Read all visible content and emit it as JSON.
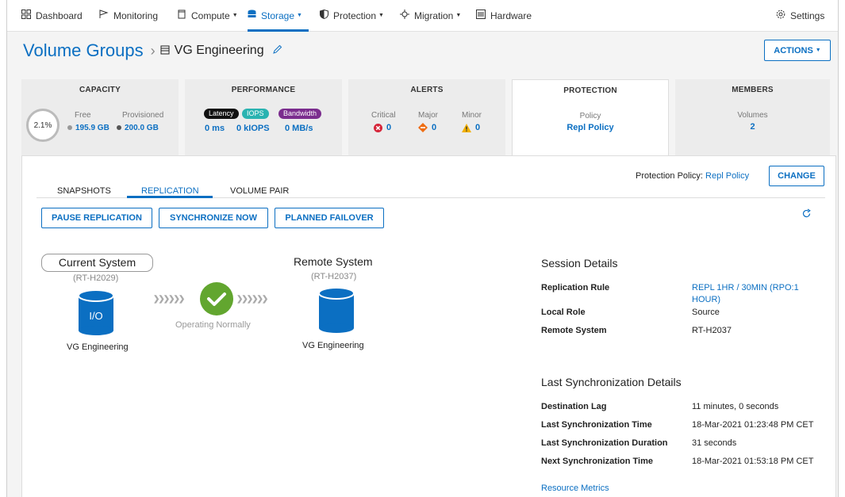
{
  "nav": {
    "dashboard": "Dashboard",
    "monitoring": "Monitoring",
    "compute": "Compute",
    "storage": "Storage",
    "protection": "Protection",
    "migration": "Migration",
    "hardware": "Hardware",
    "settings": "Settings"
  },
  "header": {
    "title": "Volume Groups",
    "subtitle": "VG Engineering",
    "actions": "ACTIONS"
  },
  "cards": {
    "capacity": {
      "title": "CAPACITY",
      "percent": "2.1%",
      "free_label": "Free",
      "free_value": "195.9 GB",
      "prov_label": "Provisioned",
      "prov_value": "200.0 GB"
    },
    "performance": {
      "title": "PERFORMANCE",
      "latency_label": "Latency",
      "iops_label": "IOPS",
      "bandwidth_label": "Bandwidth",
      "latency_value": "0 ms",
      "iops_value": "0 kIOPS",
      "bandwidth_value": "0 MB/s"
    },
    "alerts": {
      "title": "ALERTS",
      "critical_label": "Critical",
      "major_label": "Major",
      "minor_label": "Minor",
      "critical_value": "0",
      "major_value": "0",
      "minor_value": "0"
    },
    "protection": {
      "title": "PROTECTION",
      "policy_label": "Policy",
      "policy_value": "Repl Policy"
    },
    "members": {
      "title": "MEMBERS",
      "volumes_label": "Volumes",
      "volumes_value": "2"
    }
  },
  "tabs": [
    "SNAPSHOTS",
    "REPLICATION",
    "VOLUME PAIR"
  ],
  "protection_policy": {
    "label": "Protection Policy:",
    "value": "Repl Policy",
    "change": "CHANGE"
  },
  "buttons": {
    "pause": "PAUSE REPLICATION",
    "sync": "SYNCHRONIZE NOW",
    "failover": "PLANNED FAILOVER"
  },
  "diagram": {
    "current_title": "Current System",
    "current_id": "(RT-H2029)",
    "current_icon_text": "I/O",
    "current_vg": "VG Engineering",
    "status": "Operating Normally",
    "remote_title": "Remote System",
    "remote_id": "(RT-H2037)",
    "remote_vg": "VG Engineering"
  },
  "session": {
    "title": "Session Details",
    "rows": [
      {
        "key": "Replication Rule",
        "value": "REPL 1HR / 30MIN (RPO:1 HOUR)"
      },
      {
        "key": "Local Role",
        "value": "Source"
      },
      {
        "key": "Remote System",
        "value": "RT-H2037"
      }
    ]
  },
  "sync": {
    "title": "Last Synchronization Details",
    "rows": [
      {
        "key": "Destination Lag",
        "value": "11 minutes, 0 seconds"
      },
      {
        "key": "Last Synchronization Time",
        "value": "18-Mar-2021 01:23:48 PM CET"
      },
      {
        "key": "Last Synchronization Duration",
        "value": "31 seconds"
      },
      {
        "key": "Next Synchronization Time",
        "value": "18-Mar-2021 01:53:18 PM CET"
      }
    ],
    "resource_metrics": "Resource Metrics"
  }
}
